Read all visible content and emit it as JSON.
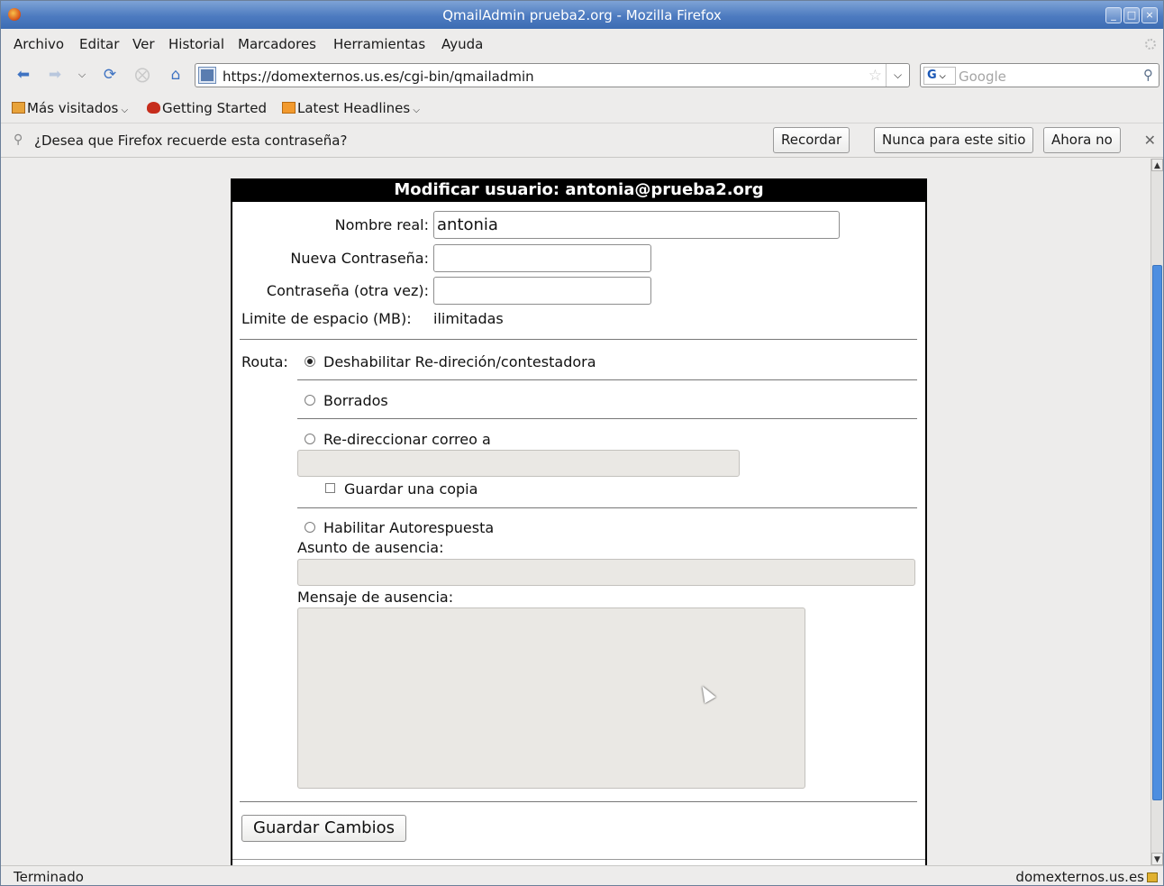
{
  "window": {
    "title": "QmailAdmin prueba2.org - Mozilla Firefox",
    "controls": [
      "_",
      "□",
      "×"
    ]
  },
  "menu": [
    "Archivo",
    "Editar",
    "Ver",
    "Historial",
    "Marcadores",
    "Herramientas",
    "Ayuda"
  ],
  "nav": {
    "url": "https://domexternos.us.es/cgi-bin/qmailadmin",
    "search_placeholder": "Google",
    "search_engine": "G"
  },
  "bookmarks": [
    "Más visitados",
    "Getting Started",
    "Latest Headlines"
  ],
  "notification": {
    "message": "¿Desea que Firefox recuerde esta contraseña?",
    "remember": "Recordar",
    "never": "Nunca para este sitio",
    "not_now": "Ahora no"
  },
  "form": {
    "header": "Modificar usuario: antonia@prueba2.org",
    "real_name_label": "Nombre real:",
    "real_name_value": "antonia",
    "new_password_label": "Nueva Contraseña:",
    "new_password_value": "",
    "repeat_password_label": "Contraseña (otra vez):",
    "repeat_password_value": "",
    "quota_label": "Limite de espacio (MB):",
    "quota_value": "ilimitadas",
    "routing_label": "Routa:",
    "option_disable": "Deshabilitar Re-direción/contestadora",
    "option_deleted": "Borrados",
    "option_forward": "Re-direccionar correo a",
    "forward_value": "",
    "keep_copy_label": "Guardar una copia",
    "option_autoreply": "Habilitar Autorespuesta",
    "subject_label": "Asunto de ausencia:",
    "subject_value": "",
    "message_label": "Mensaje de ausencia:",
    "message_value": "",
    "selected_option": "Deshabilitar Re-direción/contestadora",
    "save_button": "Guardar Cambios"
  },
  "status": {
    "left": "Terminado",
    "right": "domexternos.us.es"
  }
}
